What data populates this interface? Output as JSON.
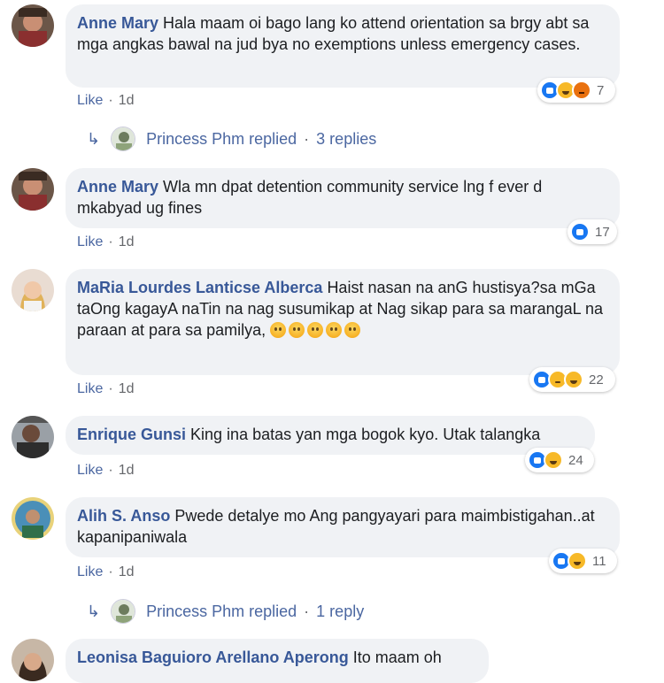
{
  "comments": [
    {
      "author": "Anne Mary",
      "text": "Hala maam oi bago lang ko attend orientation sa brgy abt sa mga angkas bawal na jud bya no exemptions unless emergency cases.",
      "action": "Like",
      "time": "1d",
      "reaction_count": "7",
      "reaction_icons": [
        "like-icon",
        "haha-icon",
        "angry-icon"
      ],
      "replies": {
        "author": "Princess Phm replied",
        "count": "3 replies"
      }
    },
    {
      "author": "Anne Mary",
      "text": "Wla mn dpat detention community service lng f ever d mkabyad ug fines",
      "action": "Like",
      "time": "1d",
      "reaction_count": "17",
      "reaction_icons": [
        "like-icon"
      ]
    },
    {
      "author": "MaRia Lourdes Lanticse Alberca",
      "text": "Haist nasan na anG hustisya?sa mGa taOng kagayA naTin na nag susumikap at Nag sikap para sa marangaL na paraan at para sa pamilya,",
      "emoji": [
        "crying-face-emoji",
        "crying-face-emoji",
        "crying-face-emoji",
        "crying-face-emoji",
        "crying-face-emoji"
      ],
      "action": "Like",
      "time": "1d",
      "reaction_count": "22",
      "reaction_icons": [
        "like-icon",
        "sad-icon",
        "haha-icon"
      ]
    },
    {
      "author": "Enrique Gunsi",
      "text": "King ina batas yan mga bogok kyo. Utak talangka",
      "action": "Like",
      "time": "1d",
      "reaction_count": "24",
      "reaction_icons": [
        "like-icon",
        "haha-icon"
      ]
    },
    {
      "author": "Alih S. Anso",
      "text": "Pwede detalye mo Ang pangyayari para maimbistigahan..at kapanipaniwala",
      "action": "Like",
      "time": "1d",
      "reaction_count": "11",
      "reaction_icons": [
        "like-icon",
        "haha-icon"
      ],
      "replies": {
        "author": "Princess Phm replied",
        "count": "1 reply"
      }
    },
    {
      "author": "Leonisa Baguioro Arellano Aperong",
      "text": "Ito maam oh"
    }
  ],
  "separator": "·",
  "colors": {
    "name": "#385898",
    "bubble": "#f0f2f5",
    "like_blue": "#1877f2",
    "meta": "#65676b"
  }
}
